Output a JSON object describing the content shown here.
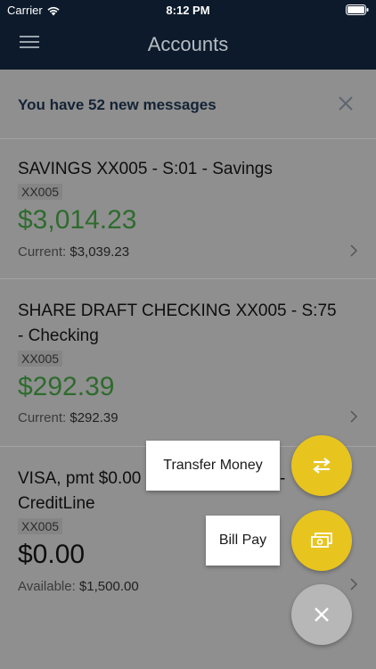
{
  "status_bar": {
    "carrier": "Carrier",
    "time": "8:12 PM"
  },
  "nav": {
    "title": "Accounts",
    "menu_icon": "hamburger-menu-icon"
  },
  "messages": {
    "text": "You have 52 new messages",
    "close_icon": "close-icon"
  },
  "accounts": [
    {
      "name": "SAVINGS XX005 - S:01 - Savings",
      "mask": "XX005",
      "balance": "$3,014.23",
      "sub_label": "Current:",
      "sub_value": "$3,039.23"
    },
    {
      "name_line1": "SHARE DRAFT CHECKING XX005 - S:75",
      "name_line2": "- Checking",
      "mask": "XX005",
      "balance": "$292.39",
      "sub_label": "Current:",
      "sub_value": "$292.39"
    },
    {
      "name_line1": "VISA, pmt $0.00",
      "name_line1_right": "-",
      "name_line2": "CreditLine",
      "mask": "XX005",
      "balance": "$0.00",
      "sub_label": "Available:",
      "sub_value": "$1,500.00"
    }
  ],
  "fab_menu": {
    "transfer_label": "Transfer Money",
    "transfer_icon": "swap-arrows-icon",
    "billpay_label": "Bill Pay",
    "billpay_icon": "cash-icon",
    "close_icon": "close-icon"
  },
  "colors": {
    "nav_bg": "#0c1a2b",
    "positive_balance": "#2e6b2e",
    "fab_yellow": "#e8c41f",
    "overlay_bg": "#8f8f8f"
  }
}
